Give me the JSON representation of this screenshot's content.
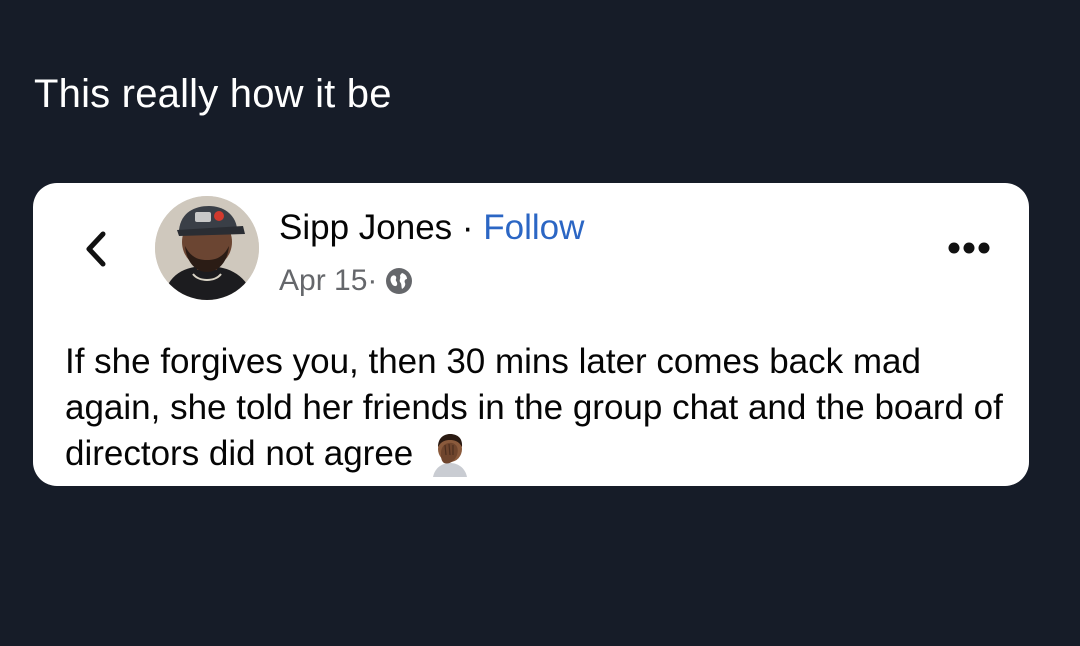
{
  "tweet": {
    "text": "This really how it be"
  },
  "post": {
    "author_name": "Sipp Jones",
    "separator": " · ",
    "follow_label": "Follow",
    "date": "Apr 15",
    "meta_separator": " · ",
    "audience_icon": "globe-icon",
    "body": "If she forgives you, then 30 mins later comes back mad again, she told her friends in the group chat and the board of directors did not agree",
    "body_emoji": "man-facepalming-emoji"
  },
  "icons": {
    "back": "chevron-left-icon",
    "more": "more-options-icon"
  },
  "colors": {
    "background": "#161c28",
    "card": "#ffffff",
    "follow": "#2b66c4",
    "meta_text": "#65676b"
  }
}
